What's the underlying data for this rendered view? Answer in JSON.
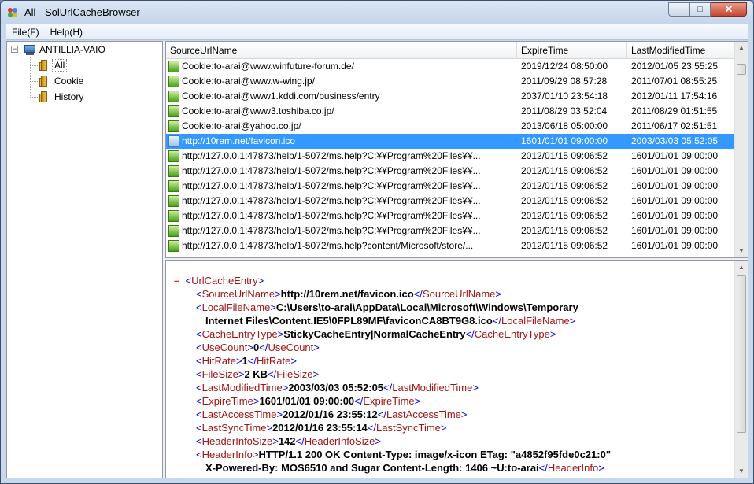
{
  "window": {
    "title": "All - SolUrlCacheBrowser"
  },
  "menu": {
    "items": [
      "File(F)",
      "Help(H)"
    ]
  },
  "tree": {
    "root": "ANTILLIA-VAIO",
    "children": [
      "All",
      "Cookie",
      "History"
    ],
    "selected": "All"
  },
  "list": {
    "columns": [
      "SourceUrlName",
      "ExpireTime",
      "LastModifiedTime"
    ],
    "rows": [
      {
        "url": "Cookie:to-arai@www.winfuture-forum.de/",
        "expire": "2019/12/24 08:50:00",
        "modified": "2012/01/05 23:55:25"
      },
      {
        "url": "Cookie:to-arai@www.w-wing.jp/",
        "expire": "2011/09/29 08:57:28",
        "modified": "2011/07/01 08:55:25"
      },
      {
        "url": "Cookie:to-arai@www1.kddi.com/business/entry",
        "expire": "2037/01/10 23:54:18",
        "modified": "2012/01/11 17:54:16"
      },
      {
        "url": "Cookie:to-arai@www3.toshiba.co.jp/",
        "expire": "2011/08/29 03:52:04",
        "modified": "2011/08/29 01:51:55"
      },
      {
        "url": "Cookie:to-arai@yahoo.co.jp/",
        "expire": "2013/06/18 05:00:00",
        "modified": "2011/06/17 02:51:51"
      },
      {
        "url": "http://10rem.net/favicon.ico",
        "expire": "1601/01/01 09:00:00",
        "modified": "2003/03/03 05:52:05",
        "selected": true
      },
      {
        "url": "http://127.0.0.1:47873/help/1-5072/ms.help?C:¥¥Program%20Files¥¥...",
        "expire": "2012/01/15 09:06:52",
        "modified": "1601/01/01 09:00:00"
      },
      {
        "url": "http://127.0.0.1:47873/help/1-5072/ms.help?C:¥¥Program%20Files¥¥...",
        "expire": "2012/01/15 09:06:52",
        "modified": "1601/01/01 09:00:00"
      },
      {
        "url": "http://127.0.0.1:47873/help/1-5072/ms.help?C:¥¥Program%20Files¥¥...",
        "expire": "2012/01/15 09:06:52",
        "modified": "1601/01/01 09:00:00"
      },
      {
        "url": "http://127.0.0.1:47873/help/1-5072/ms.help?C:¥¥Program%20Files¥¥...",
        "expire": "2012/01/15 09:06:52",
        "modified": "1601/01/01 09:00:00"
      },
      {
        "url": "http://127.0.0.1:47873/help/1-5072/ms.help?C:¥¥Program%20Files¥¥...",
        "expire": "2012/01/15 09:06:52",
        "modified": "1601/01/01 09:00:00"
      },
      {
        "url": "http://127.0.0.1:47873/help/1-5072/ms.help?C:¥¥Program%20Files¥¥...",
        "expire": "2012/01/15 09:06:52",
        "modified": "1601/01/01 09:00:00"
      },
      {
        "url": "http://127.0.0.1:47873/help/1-5072/ms.help?content/Microsoft/store/...",
        "expire": "2012/01/15 09:06:52",
        "modified": "1601/01/01 09:00:00"
      }
    ]
  },
  "detail": {
    "root_tag": "UrlCacheEntry",
    "fields": [
      {
        "tag": "SourceUrlName",
        "value": "http://10rem.net/favicon.ico"
      },
      {
        "tag": "LocalFileName",
        "value": "C:\\Users\\to-arai\\AppData\\Local\\Microsoft\\Windows\\Temporary",
        "value2": "Internet Files\\Content.IE5\\0FPL89MF\\faviconCA8BT9G8.ico"
      },
      {
        "tag": "CacheEntryType",
        "value": "StickyCacheEntry|NormalCacheEntry"
      },
      {
        "tag": "UseCount",
        "value": "0"
      },
      {
        "tag": "HitRate",
        "value": "1"
      },
      {
        "tag": "FileSize",
        "value": "2 KB"
      },
      {
        "tag": "LastModifiedTime",
        "value": "2003/03/03 05:52:05"
      },
      {
        "tag": "ExpireTime",
        "value": "1601/01/01 09:00:00"
      },
      {
        "tag": "LastAccessTime",
        "value": "2012/01/16 23:55:12"
      },
      {
        "tag": "LastSyncTime",
        "value": "2012/01/16 23:55:14"
      },
      {
        "tag": "HeaderInfoSize",
        "value": "142"
      },
      {
        "tag": "HeaderInfo",
        "value": "HTTP/1.1 200 OK Content-Type: image/x-icon ETag: \"a4852f95fde0c21:0\"",
        "value2": "X-Powered-By: MOS6510 and Sugar Content-Length: 1406 ~U:to-arai"
      }
    ]
  }
}
